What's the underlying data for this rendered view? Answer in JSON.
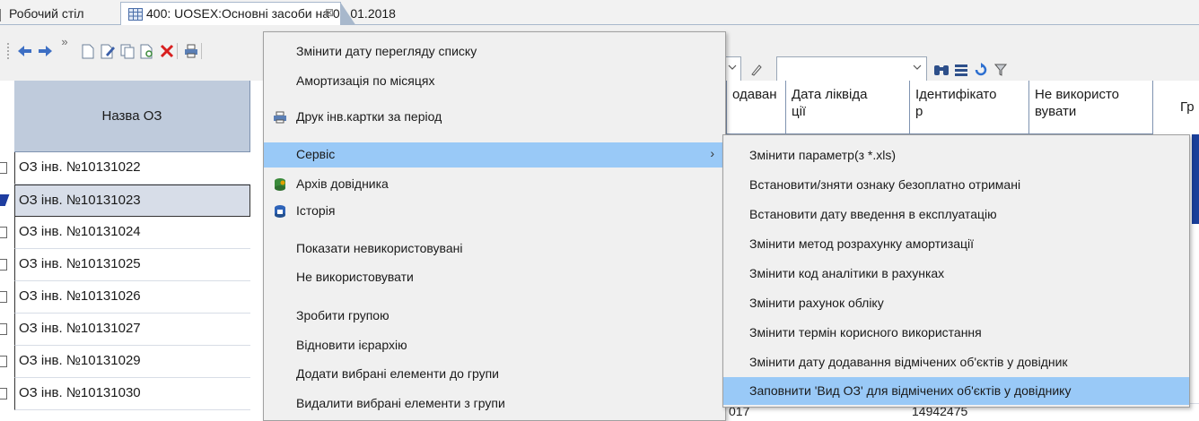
{
  "tabs": {
    "desktop": "Робочий стіл",
    "active": "400: UOSEX:Основні засоби на 01.01.2018",
    "close": "⊠"
  },
  "toolbar": {
    "chevron": "»"
  },
  "grid": {
    "name_header": "Назва ОЗ",
    "headers": [
      "одаван",
      "Дата ліквіда\nції",
      "Ідентифікато\nр",
      "Не використо\nвувати",
      "Гр"
    ],
    "rows": [
      "ОЗ інв. №10131022",
      "ОЗ інв. №10131023",
      "ОЗ інв. №10131024",
      "ОЗ інв. №10131025",
      "ОЗ інв. №10131026",
      "ОЗ інв. №10131027",
      "ОЗ інв. №10131029",
      "ОЗ інв. №10131030"
    ],
    "selected_row": 1,
    "bottom_left": "017",
    "bottom_id": "14942475"
  },
  "context_menu": {
    "items": [
      {
        "label": "Змінити дату перегляду списку",
        "icon": ""
      },
      {
        "label": "Амортизація по місяцях",
        "icon": ""
      },
      {
        "label": "Друк інв.картки за період",
        "icon": "printer-icon"
      },
      {
        "label": "Сервіс",
        "icon": "",
        "submenu": true
      },
      {
        "label": "Архів довідника",
        "icon": "archive-icon"
      },
      {
        "label": "Історія",
        "icon": "history-icon"
      },
      {
        "label": "Показати невикористовувані",
        "icon": ""
      },
      {
        "label": "Не використовувати",
        "icon": ""
      },
      {
        "label": "Зробити групою",
        "icon": ""
      },
      {
        "label": "Відновити ієрархію",
        "icon": ""
      },
      {
        "label": "Додати вибрані елементи до групи",
        "icon": ""
      },
      {
        "label": "Видалити вибрані елементи з групи",
        "icon": ""
      }
    ],
    "submenu_arrow": "›"
  },
  "service_submenu": {
    "items": [
      "Змінити параметр(з *.xls)",
      "Встановити/зняти ознаку безоплатно отримані",
      "Встановити дату введення в експлуатацію",
      "Змінити метод розрахунку амортизації",
      "Змінити код аналітики в рахунках",
      "Змінити рахунок обліку",
      "Змінити термін корисного використання",
      "Змінити дату додавання відмічених об'єктів у довідник",
      "Заповнити 'Вид ОЗ' для відмічених об'єктів у довіднику"
    ],
    "highlighted": 8
  },
  "colors": {
    "highlight": "#99c9f7",
    "header_bg": "#bfcbdc"
  }
}
